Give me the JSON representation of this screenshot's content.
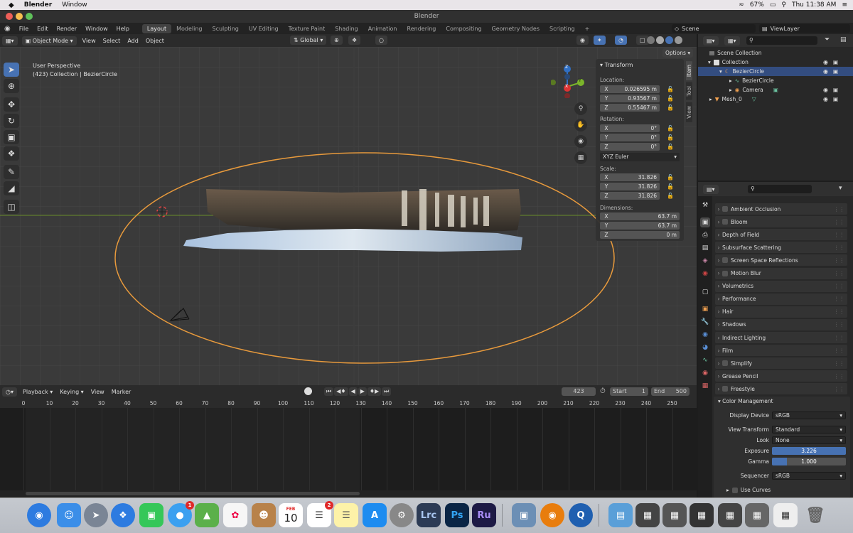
{
  "menubar": {
    "apple": "",
    "app_name": "Blender",
    "window_menu": "Window",
    "battery": "67%",
    "clock": "Thu 11:38 AM"
  },
  "window": {
    "title": "Blender"
  },
  "top_menu": [
    "File",
    "Edit",
    "Render",
    "Window",
    "Help"
  ],
  "workspaces": [
    {
      "label": "Layout",
      "active": true
    },
    {
      "label": "Modeling",
      "active": false
    },
    {
      "label": "Sculpting",
      "active": false
    },
    {
      "label": "UV Editing",
      "active": false
    },
    {
      "label": "Texture Paint",
      "active": false
    },
    {
      "label": "Shading",
      "active": false
    },
    {
      "label": "Animation",
      "active": false
    },
    {
      "label": "Rendering",
      "active": false
    },
    {
      "label": "Compositing",
      "active": false
    },
    {
      "label": "Geometry Nodes",
      "active": false
    },
    {
      "label": "Scripting",
      "active": false
    }
  ],
  "add_workspace": "+",
  "scene": {
    "label": "Scene",
    "view_layer": "ViewLayer"
  },
  "viewport_header": {
    "mode": "Object Mode",
    "menus": [
      "View",
      "Select",
      "Add",
      "Object"
    ],
    "orientation": "Global",
    "options": "Options"
  },
  "viewport": {
    "perspective": "User Perspective",
    "collection_info": "(423) Collection | BezierCircle",
    "gizmo_x": "X",
    "gizmo_y": "Y",
    "gizmo_z": "Z"
  },
  "n_panel": {
    "section": "Transform",
    "location_label": "Location:",
    "location": [
      {
        "axis": "X",
        "value": "0.026595 m"
      },
      {
        "axis": "Y",
        "value": "0.93567 m"
      },
      {
        "axis": "Z",
        "value": "0.55467 m"
      }
    ],
    "rotation_label": "Rotation:",
    "rotation": [
      {
        "axis": "X",
        "value": "0°"
      },
      {
        "axis": "Y",
        "value": "0°"
      },
      {
        "axis": "Z",
        "value": "0°"
      }
    ],
    "rotation_mode": "XYZ Euler",
    "scale_label": "Scale:",
    "scale": [
      {
        "axis": "X",
        "value": "31.826"
      },
      {
        "axis": "Y",
        "value": "31.826"
      },
      {
        "axis": "Z",
        "value": "31.826"
      }
    ],
    "dimensions_label": "Dimensions:",
    "dimensions": [
      {
        "axis": "X",
        "value": "63.7 m"
      },
      {
        "axis": "Y",
        "value": "63.7 m"
      },
      {
        "axis": "Z",
        "value": "0 m"
      }
    ],
    "tabs": [
      "Item",
      "Tool",
      "View"
    ]
  },
  "timeline": {
    "menus": [
      "Playback",
      "Keying",
      "View",
      "Marker"
    ],
    "current_frame": "423",
    "start_label": "Start",
    "start": "1",
    "end_label": "End",
    "end": "500",
    "ruler": [
      "0",
      "10",
      "20",
      "30",
      "40",
      "50",
      "60",
      "70",
      "80",
      "90",
      "100",
      "110",
      "120",
      "130",
      "140",
      "150",
      "160",
      "170",
      "180",
      "190",
      "200",
      "210",
      "220",
      "230",
      "240",
      "250"
    ]
  },
  "outliner": {
    "scene_collection": "Scene Collection",
    "rows": [
      {
        "label": "Collection",
        "indent": 1
      },
      {
        "label": "BezierCircle",
        "indent": 2,
        "selected": true
      },
      {
        "label": "BezierCircle",
        "indent": 3
      },
      {
        "label": "Camera",
        "indent": 3
      },
      {
        "label": "Mesh_0",
        "indent": 1
      }
    ]
  },
  "properties": {
    "sections": [
      {
        "label": "Ambient Occlusion",
        "checkbox": true
      },
      {
        "label": "Bloom",
        "checkbox": true
      },
      {
        "label": "Depth of Field",
        "checkbox": false
      },
      {
        "label": "Subsurface Scattering",
        "checkbox": false
      },
      {
        "label": "Screen Space Reflections",
        "checkbox": true
      },
      {
        "label": "Motion Blur",
        "checkbox": true
      },
      {
        "label": "Volumetrics",
        "checkbox": false
      },
      {
        "label": "Performance",
        "checkbox": false
      },
      {
        "label": "Hair",
        "checkbox": false
      },
      {
        "label": "Shadows",
        "checkbox": false
      },
      {
        "label": "Indirect Lighting",
        "checkbox": false
      },
      {
        "label": "Film",
        "checkbox": false
      },
      {
        "label": "Simplify",
        "checkbox": true
      },
      {
        "label": "Grease Pencil",
        "checkbox": false
      },
      {
        "label": "Freestyle",
        "checkbox": true
      }
    ],
    "color_management": {
      "title": "Color Management",
      "display_device_label": "Display Device",
      "display_device": "sRGB",
      "view_transform_label": "View Transform",
      "view_transform": "Standard",
      "look_label": "Look",
      "look": "None",
      "exposure_label": "Exposure",
      "exposure": "3.226",
      "exposure_fill": 1.0,
      "gamma_label": "Gamma",
      "gamma": "1.000",
      "gamma_fill": 0.2,
      "sequencer_label": "Sequencer",
      "sequencer": "sRGB",
      "use_curves": "Use Curves"
    }
  },
  "dock": {
    "mail_badge": "1",
    "reminders_badge": "2",
    "calendar_month": "FEB",
    "calendar_day": "10",
    "lrc": "Lrc",
    "ps": "Ps",
    "ru": "Ru"
  },
  "colors": {
    "accent": "#4772b3",
    "circle": "#e89a3c",
    "grid_bg": "#3a3a3a"
  }
}
